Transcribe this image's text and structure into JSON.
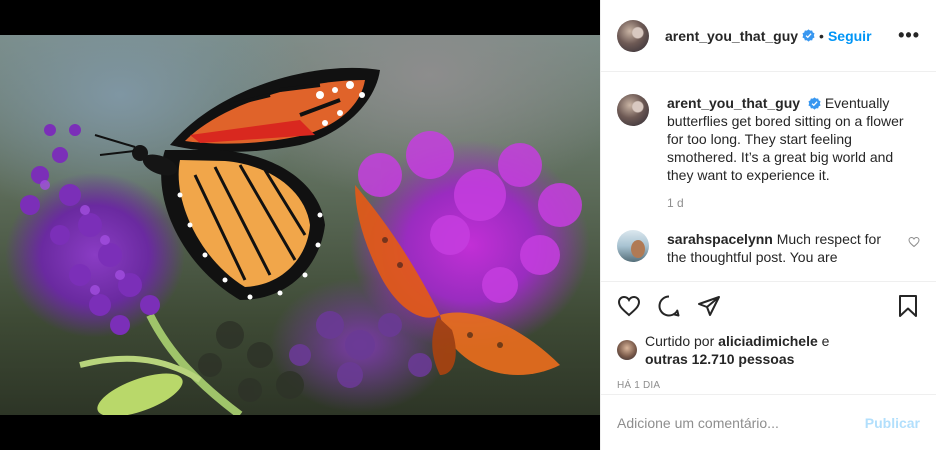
{
  "post": {
    "username": "arent_you_that_guy",
    "follow_label": "Seguir",
    "separator": "•",
    "more_label": "•••",
    "caption_text": "Eventually butterflies get bored sitting on a flower for too long. They start feeling smothered. It’s a great big world and they want to experience it.",
    "caption_time": "1 d"
  },
  "comments": [
    {
      "username": "sarahspacelynn",
      "text": "Much respect for the thoughtful post. You are"
    }
  ],
  "likes": {
    "prefix": "Curtido por",
    "first_user": "aliciadimichele",
    "conjunction": "e",
    "others": "outras 12.710 pessoas"
  },
  "posted_ago": "HÁ 1 DIA",
  "comment_box": {
    "placeholder": "Adicione um comentário...",
    "publish_label": "Publicar"
  },
  "colors": {
    "link_blue": "#0095f6",
    "verified_blue": "#3897f0",
    "muted_gray": "#8e8e8e",
    "publish_disabled": "#b2dffc"
  }
}
